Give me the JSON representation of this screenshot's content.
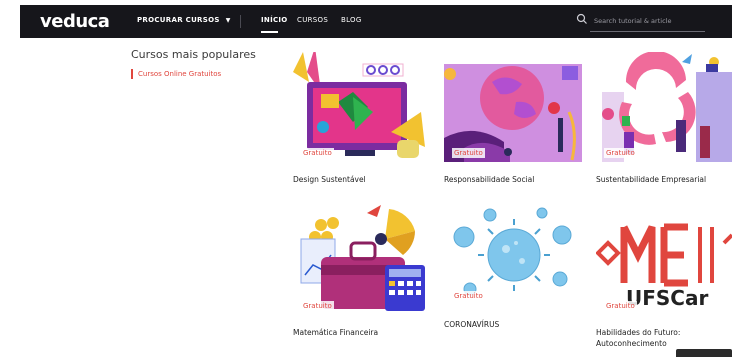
{
  "nav": {
    "logo": "veduca",
    "browse_label": "PROCURAR CURSOS",
    "links": [
      "INÍCIO",
      "CURSOS",
      "BLOG"
    ],
    "search_placeholder": "Search tutorial & article"
  },
  "sidebar": {
    "title": "Cursos mais populares",
    "filter": "Cursos Online Gratuitos"
  },
  "courses": [
    {
      "title": "Design Sustentável",
      "badge": "Gratuito"
    },
    {
      "title": "Responsabilidade Social",
      "badge": "Gratuito"
    },
    {
      "title": "Sustentabilidade Empresarial",
      "badge": "Gratuito"
    },
    {
      "title": "Matemática Financeira",
      "badge": "Gratuito"
    },
    {
      "title": "CORONAVÍRUS",
      "badge": "Gratuito"
    },
    {
      "title": "Habilidades do Futuro: Autoconhecimento",
      "badge": "Gratuito",
      "image_text": "UFSCar"
    }
  ],
  "colors": {
    "accent": "#e0463e",
    "nav_bg": "#16161b"
  }
}
